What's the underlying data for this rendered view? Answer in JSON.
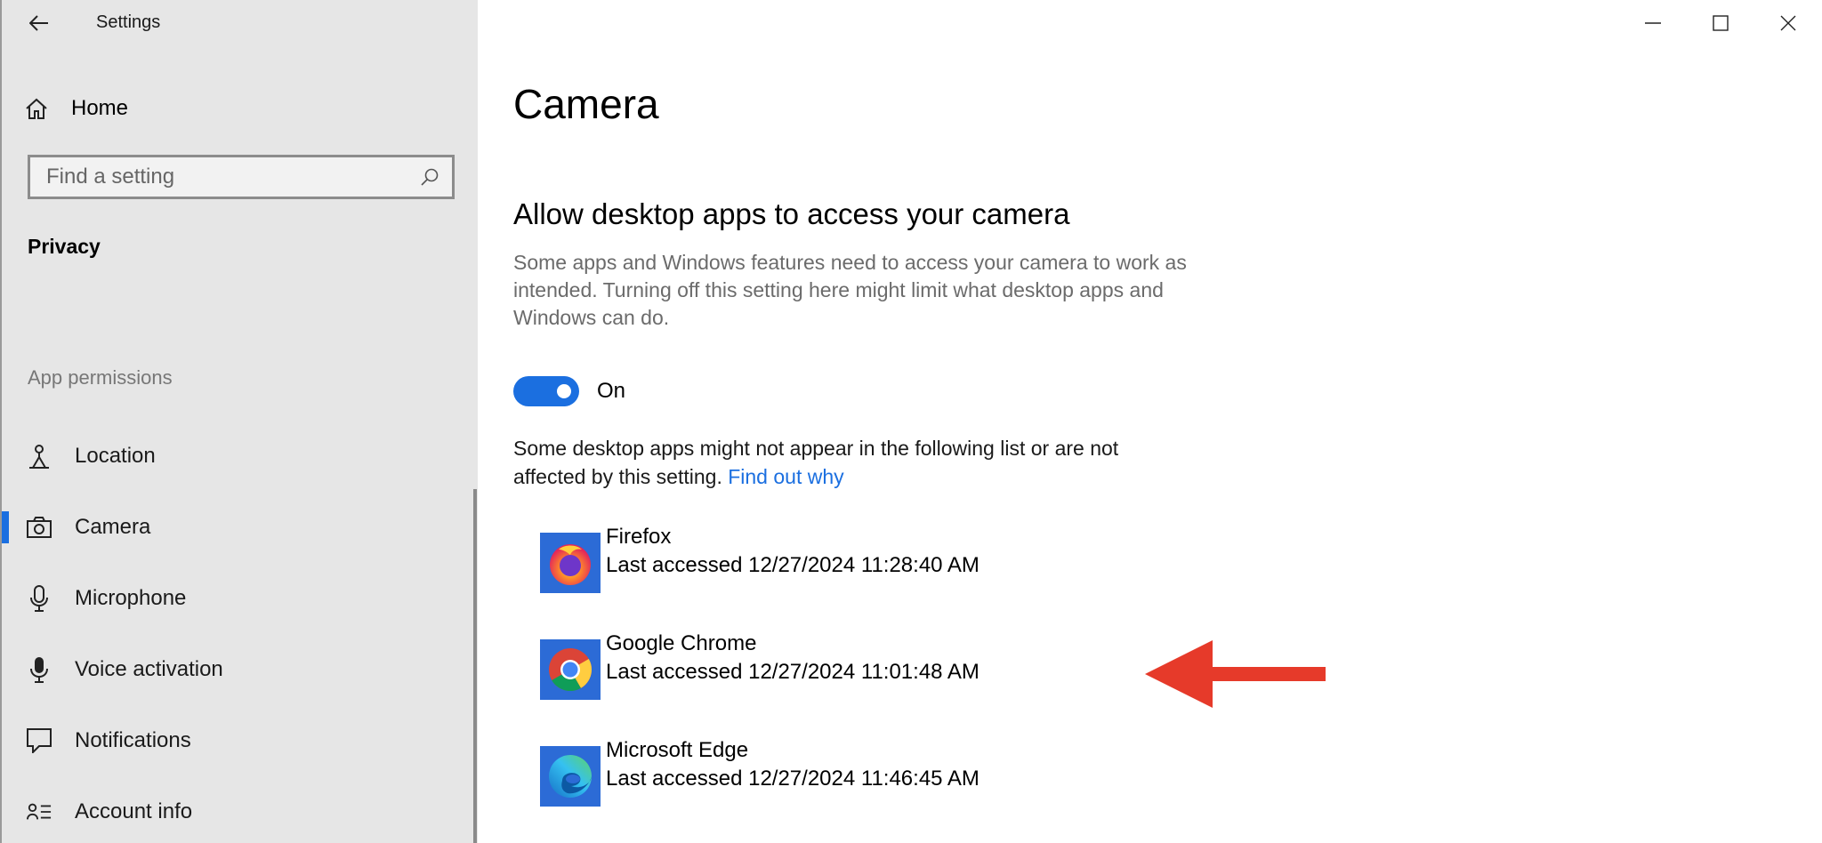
{
  "window": {
    "title": "Settings",
    "controls": [
      "minimize-icon",
      "maximize-icon",
      "close-icon"
    ]
  },
  "sidebar": {
    "home_label": "Home",
    "search": {
      "placeholder": "Find a setting"
    },
    "section_heading": "Privacy",
    "group_heading": "App permissions",
    "items": [
      {
        "label": "Location",
        "icon": "location-icon",
        "active": false
      },
      {
        "label": "Camera",
        "icon": "camera-icon",
        "active": true
      },
      {
        "label": "Microphone",
        "icon": "microphone-icon",
        "active": false
      },
      {
        "label": "Voice activation",
        "icon": "voice-activation-icon",
        "active": false
      },
      {
        "label": "Notifications",
        "icon": "notifications-icon",
        "active": false
      },
      {
        "label": "Account info",
        "icon": "account-info-icon",
        "active": false
      }
    ]
  },
  "main": {
    "page_title": "Camera",
    "section_title": "Allow desktop apps to access your camera",
    "section_desc": "Some apps and Windows features need to access your camera to work as intended. Turning off this setting here might limit what desktop apps and Windows can do.",
    "toggle": {
      "state": "On",
      "on": true
    },
    "note_text": "Some desktop apps might not appear in the following list or are not affected by this setting.",
    "note_link": "Find out why",
    "apps": [
      {
        "name": "Firefox",
        "last_accessed": "Last accessed 12/27/2024 11:28:40 AM",
        "icon": "firefox-icon"
      },
      {
        "name": "Google Chrome",
        "last_accessed": "Last accessed 12/27/2024 11:01:48 AM",
        "icon": "chrome-icon"
      },
      {
        "name": "Microsoft Edge",
        "last_accessed": "Last accessed 12/27/2024 11:46:45 AM",
        "icon": "edge-icon"
      }
    ]
  },
  "colors": {
    "accent": "#1b6fe0",
    "sidebar_bg": "#e6e6e6",
    "annotation_arrow": "#e63a2a"
  }
}
